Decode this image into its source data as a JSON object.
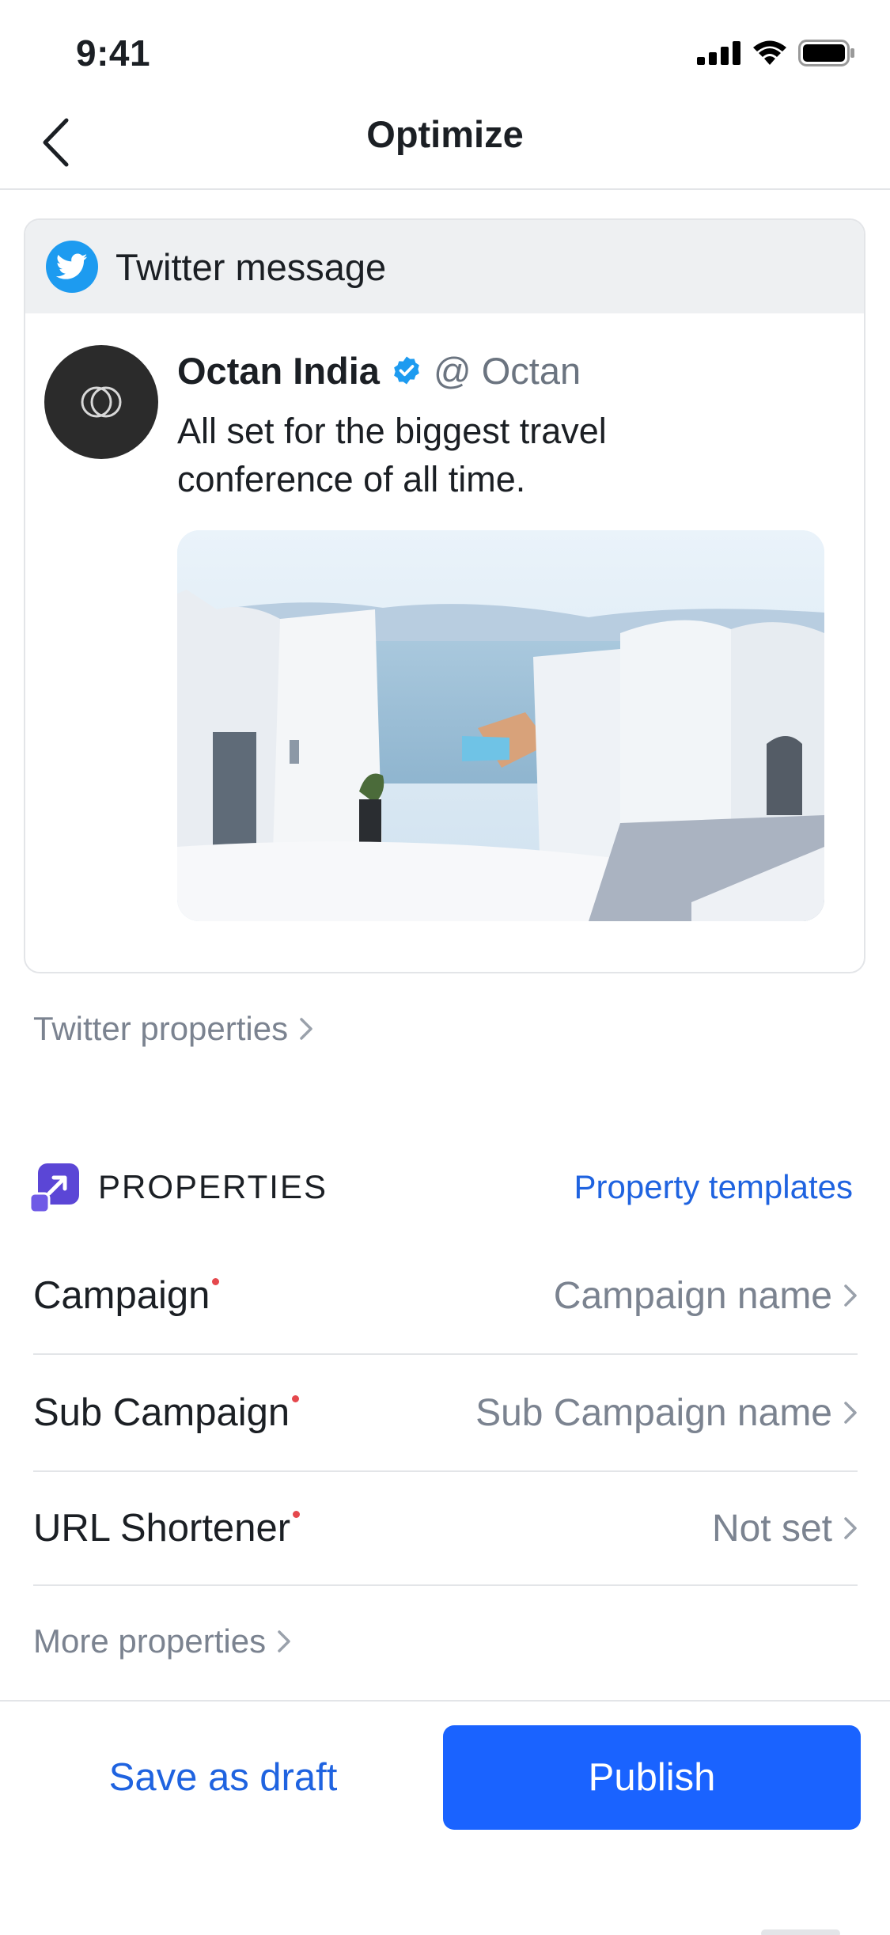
{
  "status_bar": {
    "time": "9:41"
  },
  "nav": {
    "title": "Optimize",
    "back_icon": "chevron-left-icon"
  },
  "tweet_card": {
    "header_title": "Twitter message",
    "account_name": "Octan India",
    "handle": "@ Octan",
    "text": "All set for the biggest travel conference of all time.",
    "accent_color": "#1d9bf0"
  },
  "twitter_properties_link": "Twitter properties",
  "properties": {
    "title": "PROPERTIES",
    "templates_link": "Property templates",
    "rows": [
      {
        "label": "Campaign",
        "value": "Campaign name",
        "required": true
      },
      {
        "label": "Sub Campaign",
        "value": "Sub Campaign name",
        "required": true
      },
      {
        "label": "URL Shortener",
        "value": "Not set",
        "required": true
      }
    ],
    "more_link": "More properties"
  },
  "actions": {
    "draft_label": "Save as draft",
    "publish_label": "Publish",
    "primary_color": "#1a63ff"
  }
}
